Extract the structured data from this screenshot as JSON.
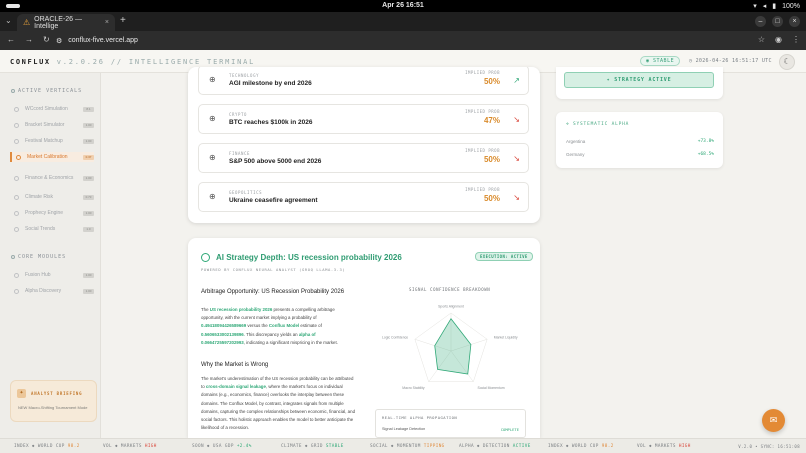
{
  "os": {
    "clock": "Apr 26  16:51",
    "battery": "100%"
  },
  "browser": {
    "tab_title": "ORACLE-26 — Intellige",
    "url": "conflux-five.vercel.app"
  },
  "header": {
    "brand": "CONFLUX",
    "version": "v.2.0.26 // INTELLIGENCE TERMINAL",
    "status": "STABLE",
    "timestamp": "2026-04-26 16:51:17 UTC"
  },
  "sidebar": {
    "active_verticals_title": "ACTIVE VERTICALS",
    "verticals": [
      {
        "label": "WCcord Simulation",
        "count": "8.1"
      },
      {
        "label": "Bracket Simulator",
        "count": "1.00"
      },
      {
        "label": "Festival Matchup",
        "count": "1.00"
      },
      {
        "label": "Market Calibration",
        "count": "0.37"
      },
      {
        "label": "Finance & Economics",
        "count": "1.00"
      },
      {
        "label": "Climate Risk",
        "count": "0.73"
      },
      {
        "label": "Prophecy Engine",
        "count": "1.00"
      },
      {
        "label": "Social Trends",
        "count": "1.0"
      }
    ],
    "core_modules_title": "CORE MODULES",
    "modules": [
      {
        "label": "Fusion Hub",
        "count": "1.00"
      },
      {
        "label": "Alpha Discovery",
        "count": "1.00"
      }
    ],
    "briefing_title": "ANALYST BRIEFING",
    "briefing_text": "NEW Macro-Shifting Tournament Mode"
  },
  "markets": [
    {
      "category": "TECHNOLOGY",
      "question": "AGI milestone by end 2026",
      "prob_label": "IMPLIED PROB",
      "prob": "50%",
      "direction": "up"
    },
    {
      "category": "CRYPTO",
      "question": "BTC reaches $100k in 2026",
      "prob_label": "IMPLIED PROB",
      "prob": "47%",
      "direction": "down"
    },
    {
      "category": "FINANCE",
      "question": "S&P 500 above 5000 end 2026",
      "prob_label": "IMPLIED PROB",
      "prob": "50%",
      "direction": "down"
    },
    {
      "category": "GEOPOLITICS",
      "question": "Ukraine ceasefire agreement",
      "prob_label": "IMPLIED PROB",
      "prob": "50%",
      "direction": "down"
    }
  ],
  "strategy": {
    "label": "STRATEGY ACTIVE"
  },
  "systematic_alpha": {
    "title": "SYSTEMATIC ALPHA",
    "rows": [
      {
        "label": "Argentina",
        "value": "+73.8%"
      },
      {
        "label": "Germany",
        "value": "+68.5%"
      }
    ]
  },
  "depth": {
    "title": "AI Strategy Depth: US recession probability 2026",
    "badge": "EXECUTION: ACTIVE",
    "powered": "POWERED BY CONFLUX NEURAL ANALYST (GROQ LLAMA-3.3)",
    "heading": "Arbitrage Opportunity: US Recession Probability 2026",
    "p1_a": "The ",
    "p1_b": "US recession probability 2026",
    "p1_c": " presents a compelling arbitrage opportunity, with the current market implying a probability of ",
    "p1_d": "0.49418094426589669",
    "p1_e": " versus the ",
    "p1_f": "Conflux Model",
    "p1_g": " estimate of ",
    "p1_h": "0.5606533002139896",
    "p1_i": ". This discrepancy yields an ",
    "p1_j": "alpha of 0.0664725597202993",
    "p1_k": ", indicating a significant mispricing in the market.",
    "heading2": "Why the Market is Wrong",
    "p2_a": "The market's underestimation of the US recession probability can be attributed to ",
    "p2_b": "cross-domain signal leakage",
    "p2_c": ", where the market's focus on individual domains (e.g., economics, finance) overlooks the interplay between these domains. The Conflux Model, by contrast, integrates signals from multiple domains, capturing the complex relationships between economic, financial, and social factors. This holistic approach enables the model to better anticipate the likelihood of a recession.",
    "radar_title": "SIGNAL CONFIDENCE BREAKDOWN",
    "radar_axes": [
      "Sports Alignment",
      "Market Liquidity",
      "Social Momentum",
      "Macro Stability",
      "Logic Confidence"
    ],
    "radar_values": [
      0.85,
      0.55,
      0.75,
      0.6,
      0.45
    ],
    "rt_title": "REAL-TIME ALPHA PROPAGATION",
    "rt_label": "Signal Leakage Detection",
    "rt_status": "COMPLETE"
  },
  "ticker": [
    {
      "label": "INDEX ◆ WORLD CUP",
      "value": "98.2",
      "tone": "warm"
    },
    {
      "label": "VOL ◆ MARKETS",
      "value": "HIGH",
      "tone": "neg"
    },
    {
      "label": "SOON ◆ USA GDP",
      "value": "+2.4%",
      "tone": "pos"
    },
    {
      "label": "CLIMATE ◆ GRID",
      "value": "STABLE",
      "tone": "pos"
    },
    {
      "label": "SOCIAL ◆ MOMENTUM",
      "value": "TIPPING",
      "tone": "warm"
    },
    {
      "label": "ALPHA ◆ DETECTION",
      "value": "ACTIVE",
      "tone": "pos"
    },
    {
      "label": "INDEX ◆ WORLD CUP",
      "value": "98.2",
      "tone": "warm"
    },
    {
      "label": "VOL ◆ MARKETS",
      "value": "HIGH",
      "tone": "neg"
    }
  ],
  "ticker_stamp": "V.2.0 • SYNC: 16:51:08",
  "colors": {
    "accent_green": "#2fa877",
    "accent_orange": "#e08a3c",
    "down_red": "#d9463a"
  }
}
